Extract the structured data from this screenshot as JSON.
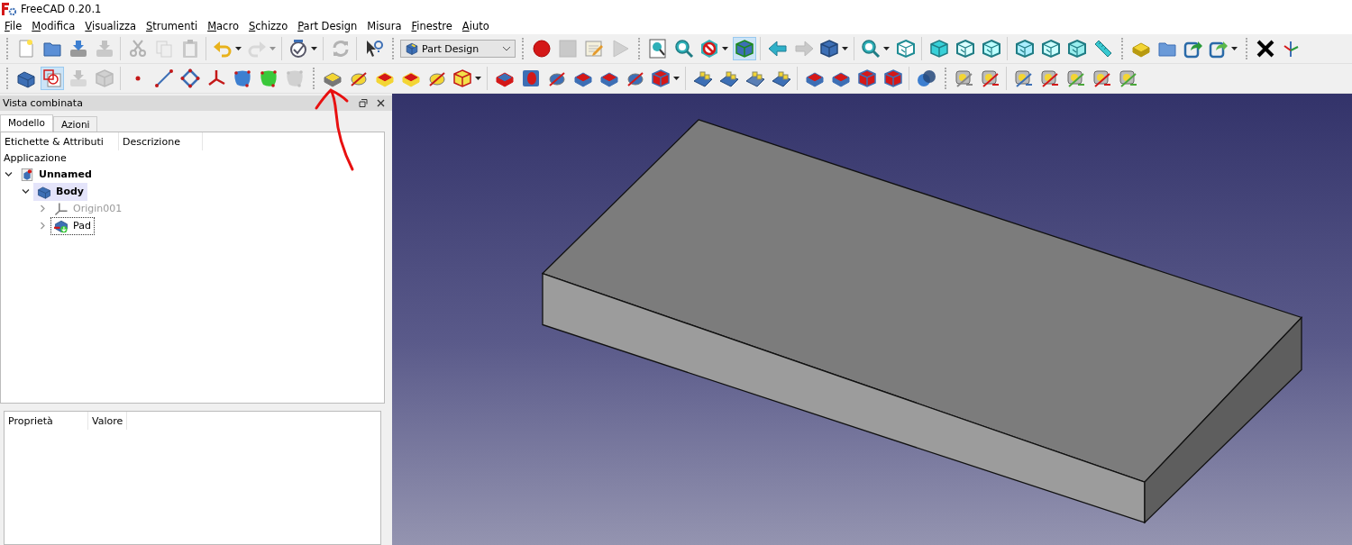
{
  "window": {
    "title": "FreeCAD 0.20.1"
  },
  "menu": [
    {
      "label": "File",
      "mnemonic": true
    },
    {
      "label": "Modifica",
      "mnemonic": true
    },
    {
      "label": "Visualizza",
      "mnemonic": true
    },
    {
      "label": "Strumenti",
      "mnemonic": true
    },
    {
      "label": "Macro",
      "mnemonic": true
    },
    {
      "label": "Schizzo",
      "mnemonic": true
    },
    {
      "label": "Part Design",
      "mnemonic": true
    },
    {
      "label": "Misura",
      "mnemonic": false
    },
    {
      "label": "Finestre",
      "mnemonic": true
    },
    {
      "label": "Aiuto",
      "mnemonic": true
    }
  ],
  "toolbars": [
    [
      {
        "grip": true,
        "tools": [
          {
            "kind": "new-file",
            "selected": false,
            "disabled": false,
            "dropdown": false
          },
          {
            "kind": "open",
            "selected": false,
            "disabled": false,
            "dropdown": false
          },
          {
            "kind": "save",
            "selected": false,
            "disabled": false,
            "dropdown": false
          },
          {
            "kind": "save-as",
            "selected": false,
            "disabled": true,
            "dropdown": false
          }
        ]
      },
      {
        "grip": false,
        "tools": [
          {
            "kind": "cut",
            "selected": false,
            "disabled": true,
            "dropdown": false
          },
          {
            "kind": "copy",
            "selected": false,
            "disabled": true,
            "dropdown": false
          },
          {
            "kind": "paste",
            "selected": false,
            "disabled": true,
            "dropdown": false
          }
        ]
      },
      {
        "grip": false,
        "tools": [
          {
            "kind": "undo",
            "selected": false,
            "disabled": false,
            "dropdown": true
          },
          {
            "kind": "redo",
            "selected": false,
            "disabled": true,
            "dropdown": true
          }
        ]
      },
      {
        "grip": false,
        "tools": [
          {
            "kind": "gauge",
            "selected": false,
            "disabled": false,
            "dropdown": true
          }
        ]
      },
      {
        "grip": false,
        "tools": [
          {
            "kind": "refresh",
            "selected": false,
            "disabled": true,
            "dropdown": false
          }
        ]
      },
      {
        "grip": false,
        "tools": [
          {
            "kind": "whats-this",
            "selected": false,
            "disabled": false,
            "dropdown": false
          }
        ]
      },
      {
        "grip": true,
        "workbench": "Part Design"
      },
      {
        "grip": true,
        "tools": [
          {
            "kind": "record",
            "selected": false,
            "disabled": false,
            "dropdown": false
          },
          {
            "kind": "stop",
            "selected": false,
            "disabled": true,
            "dropdown": false
          },
          {
            "kind": "macro-edit",
            "selected": false,
            "disabled": false,
            "dropdown": false
          },
          {
            "kind": "play",
            "selected": false,
            "disabled": true,
            "dropdown": false
          }
        ]
      },
      {
        "grip": true,
        "tools": [
          {
            "kind": "fit-all",
            "selected": false,
            "disabled": false,
            "dropdown": false
          },
          {
            "kind": "fit-selection",
            "selected": false,
            "disabled": false,
            "dropdown": false
          },
          {
            "kind": "draw-style",
            "selected": false,
            "disabled": false,
            "dropdown": true
          },
          {
            "kind": "bounding-box",
            "selected": true,
            "disabled": false,
            "dropdown": false
          }
        ]
      },
      {
        "grip": false,
        "tools": [
          {
            "kind": "back",
            "selected": false,
            "disabled": false,
            "dropdown": false
          },
          {
            "kind": "forward",
            "selected": false,
            "disabled": true,
            "dropdown": false
          },
          {
            "kind": "view-menu",
            "selected": false,
            "disabled": false,
            "dropdown": true
          }
        ]
      },
      {
        "grip": false,
        "tools": [
          {
            "kind": "zoom",
            "selected": false,
            "disabled": false,
            "dropdown": true
          },
          {
            "kind": "view-iso",
            "selected": false,
            "disabled": false,
            "dropdown": false
          }
        ]
      },
      {
        "grip": false,
        "tools": [
          {
            "kind": "view-front",
            "selected": false,
            "disabled": false,
            "dropdown": false
          },
          {
            "kind": "view-top",
            "selected": false,
            "disabled": false,
            "dropdown": false
          },
          {
            "kind": "view-right",
            "selected": false,
            "disabled": false,
            "dropdown": false
          }
        ]
      },
      {
        "grip": false,
        "tools": [
          {
            "kind": "view-rear",
            "selected": false,
            "disabled": false,
            "dropdown": false
          },
          {
            "kind": "view-bottom",
            "selected": false,
            "disabled": false,
            "dropdown": false
          },
          {
            "kind": "view-left",
            "selected": false,
            "disabled": false,
            "dropdown": false
          },
          {
            "kind": "measure-ruler",
            "selected": false,
            "disabled": false,
            "dropdown": false
          }
        ]
      },
      {
        "grip": true,
        "tools": [
          {
            "kind": "part",
            "selected": false,
            "disabled": false,
            "dropdown": false
          },
          {
            "kind": "group",
            "selected": false,
            "disabled": false,
            "dropdown": false
          },
          {
            "kind": "link",
            "selected": false,
            "disabled": false,
            "dropdown": false
          },
          {
            "kind": "link-sub",
            "selected": false,
            "disabled": false,
            "dropdown": true
          }
        ]
      },
      {
        "grip": true,
        "tools": [
          {
            "kind": "close-x",
            "selected": false,
            "disabled": false,
            "dropdown": false
          },
          {
            "kind": "axis-cross",
            "selected": false,
            "disabled": false,
            "dropdown": false
          }
        ]
      }
    ],
    [
      {
        "grip": true,
        "tools": [
          {
            "kind": "body",
            "selected": false,
            "disabled": false,
            "dropdown": false
          },
          {
            "kind": "sketch",
            "selected": true,
            "disabled": false,
            "dropdown": false
          },
          {
            "kind": "import",
            "selected": false,
            "disabled": true,
            "dropdown": false
          },
          {
            "kind": "clone",
            "selected": false,
            "disabled": true,
            "dropdown": false
          }
        ]
      },
      {
        "grip": false,
        "tools": [
          {
            "kind": "point",
            "selected": false,
            "disabled": false,
            "dropdown": false
          },
          {
            "kind": "line",
            "selected": false,
            "disabled": false,
            "dropdown": false
          },
          {
            "kind": "plane",
            "selected": false,
            "disabled": false,
            "dropdown": false
          },
          {
            "kind": "lcs",
            "selected": false,
            "disabled": false,
            "dropdown": false
          },
          {
            "kind": "shape-binder",
            "selected": false,
            "disabled": false,
            "dropdown": false
          },
          {
            "kind": "subshape-binder",
            "selected": false,
            "disabled": false,
            "dropdown": false
          },
          {
            "kind": "sheep",
            "selected": false,
            "disabled": true,
            "dropdown": false
          }
        ]
      },
      {
        "grip": true,
        "tools": [
          {
            "kind": "pad",
            "selected": false,
            "disabled": false,
            "dropdown": false
          },
          {
            "kind": "revolution",
            "selected": false,
            "disabled": false,
            "dropdown": false
          },
          {
            "kind": "loft",
            "selected": false,
            "disabled": false,
            "dropdown": false
          },
          {
            "kind": "pipe",
            "selected": false,
            "disabled": false,
            "dropdown": false
          },
          {
            "kind": "helix",
            "selected": false,
            "disabled": false,
            "dropdown": false
          },
          {
            "kind": "additive-box",
            "selected": false,
            "disabled": false,
            "dropdown": true
          }
        ]
      },
      {
        "grip": false,
        "tools": [
          {
            "kind": "pocket",
            "selected": false,
            "disabled": false,
            "dropdown": false
          },
          {
            "kind": "hole",
            "selected": false,
            "disabled": false,
            "dropdown": false
          },
          {
            "kind": "groove",
            "selected": false,
            "disabled": false,
            "dropdown": false
          },
          {
            "kind": "sub-loft",
            "selected": false,
            "disabled": false,
            "dropdown": false
          },
          {
            "kind": "sub-pipe",
            "selected": false,
            "disabled": false,
            "dropdown": false
          },
          {
            "kind": "sub-helix",
            "selected": false,
            "disabled": false,
            "dropdown": false
          },
          {
            "kind": "sub-box",
            "selected": false,
            "disabled": false,
            "dropdown": true
          }
        ]
      },
      {
        "grip": false,
        "tools": [
          {
            "kind": "mirror",
            "selected": false,
            "disabled": false,
            "dropdown": false
          },
          {
            "kind": "linear",
            "selected": false,
            "disabled": false,
            "dropdown": false
          },
          {
            "kind": "polar",
            "selected": false,
            "disabled": false,
            "dropdown": false
          },
          {
            "kind": "multi",
            "selected": false,
            "disabled": false,
            "dropdown": false
          }
        ]
      },
      {
        "grip": false,
        "tools": [
          {
            "kind": "fillet",
            "selected": false,
            "disabled": false,
            "dropdown": false
          },
          {
            "kind": "chamfer",
            "selected": false,
            "disabled": false,
            "dropdown": false
          },
          {
            "kind": "draft",
            "selected": false,
            "disabled": false,
            "dropdown": false
          },
          {
            "kind": "thickness",
            "selected": false,
            "disabled": false,
            "dropdown": false
          }
        ]
      },
      {
        "grip": false,
        "tools": [
          {
            "kind": "boolean",
            "selected": false,
            "disabled": false,
            "dropdown": false
          }
        ]
      },
      {
        "grip": true,
        "tools": [
          {
            "kind": "measure",
            "selected": false,
            "disabled": false,
            "dropdown": false
          },
          {
            "kind": "measure-angle",
            "selected": false,
            "disabled": false,
            "dropdown": false
          }
        ]
      },
      {
        "grip": false,
        "tools": [
          {
            "kind": "measure-refresh",
            "selected": false,
            "disabled": false,
            "dropdown": false
          },
          {
            "kind": "measure-clear",
            "selected": false,
            "disabled": false,
            "dropdown": false
          },
          {
            "kind": "measure-toggle",
            "selected": false,
            "disabled": false,
            "dropdown": false
          },
          {
            "kind": "measure-toggle-3d",
            "selected": false,
            "disabled": false,
            "dropdown": false
          },
          {
            "kind": "measure-delta",
            "selected": false,
            "disabled": false,
            "dropdown": false
          }
        ]
      }
    ]
  ],
  "combo_view": {
    "title": "Vista combinata",
    "tabs": [
      {
        "label": "Modello",
        "selected": true
      },
      {
        "label": "Azioni",
        "selected": false
      }
    ],
    "tree": {
      "columns": [
        "Etichette & Attributi",
        "Descrizione"
      ],
      "root": "Applicazione",
      "children": [
        {
          "label": "Unnamed",
          "kind": "document",
          "active": true,
          "expanded": true,
          "selected": false,
          "visible": true,
          "focused": false,
          "children": [
            {
              "label": "Body",
              "kind": "body",
              "active": true,
              "expanded": true,
              "selected": true,
              "visible": true,
              "focused": false,
              "children": [
                {
                  "label": "Origin001",
                  "kind": "origin",
                  "active": false,
                  "expanded": false,
                  "selected": false,
                  "visible": false,
                  "focused": false
                },
                {
                  "label": "Pad",
                  "kind": "pad",
                  "active": false,
                  "expanded": false,
                  "selected": false,
                  "visible": true,
                  "focused": true
                }
              ]
            }
          ]
        }
      ]
    },
    "properties": {
      "columns": [
        "Proprietà",
        "Valore"
      ]
    }
  }
}
